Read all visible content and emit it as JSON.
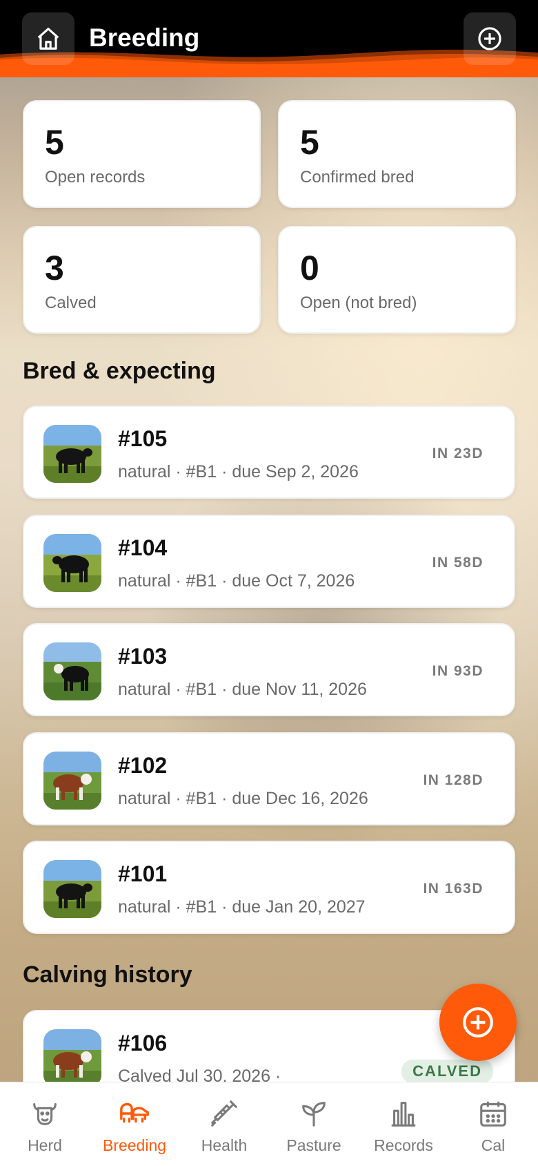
{
  "header": {
    "title": "Breeding",
    "home_icon": "home-icon",
    "add_icon": "plus-circle-icon"
  },
  "stats": [
    {
      "value": "5",
      "label": "Open records"
    },
    {
      "value": "5",
      "label": "Confirmed bred"
    },
    {
      "value": "3",
      "label": "Calved"
    },
    {
      "value": "0",
      "label": "Open (not bred)"
    }
  ],
  "sections": {
    "bred_title": "Bred & expecting",
    "history_title": "Calving history"
  },
  "bred_records": [
    {
      "id": "#105",
      "detail": "natural · #B1 · due Sep 2, 2026",
      "due": "IN 23D",
      "coat": "black"
    },
    {
      "id": "#104",
      "detail": "natural · #B1 · due Oct 7, 2026",
      "due": "IN 58D",
      "coat": "black"
    },
    {
      "id": "#103",
      "detail": "natural · #B1 · due Nov 11, 2026",
      "due": "IN 93D",
      "coat": "black-white-face"
    },
    {
      "id": "#102",
      "detail": "natural · #B1 · due Dec 16, 2026",
      "due": "IN 128D",
      "coat": "hereford"
    },
    {
      "id": "#101",
      "detail": "natural · #B1 · due Jan 20, 2027",
      "due": "IN 163D",
      "coat": "black"
    }
  ],
  "history_records": [
    {
      "id": "#106",
      "detail": "Calved Jul 30, 2026 ·",
      "badge": "CALVED",
      "coat": "hereford"
    }
  ],
  "tabs": [
    {
      "label": "Herd",
      "icon": "cow-head-icon",
      "active": false
    },
    {
      "label": "Breeding",
      "icon": "cattle-pair-icon",
      "active": true
    },
    {
      "label": "Health",
      "icon": "syringe-icon",
      "active": false
    },
    {
      "label": "Pasture",
      "icon": "sprout-icon",
      "active": false
    },
    {
      "label": "Records",
      "icon": "bar-chart-icon",
      "active": false
    },
    {
      "label": "Cal",
      "icon": "calendar-icon",
      "active": false
    }
  ],
  "colors": {
    "accent": "#ff5a0a",
    "header_bg": "#000000",
    "badge_bg": "#e3efe4",
    "badge_text": "#3a7a47"
  }
}
